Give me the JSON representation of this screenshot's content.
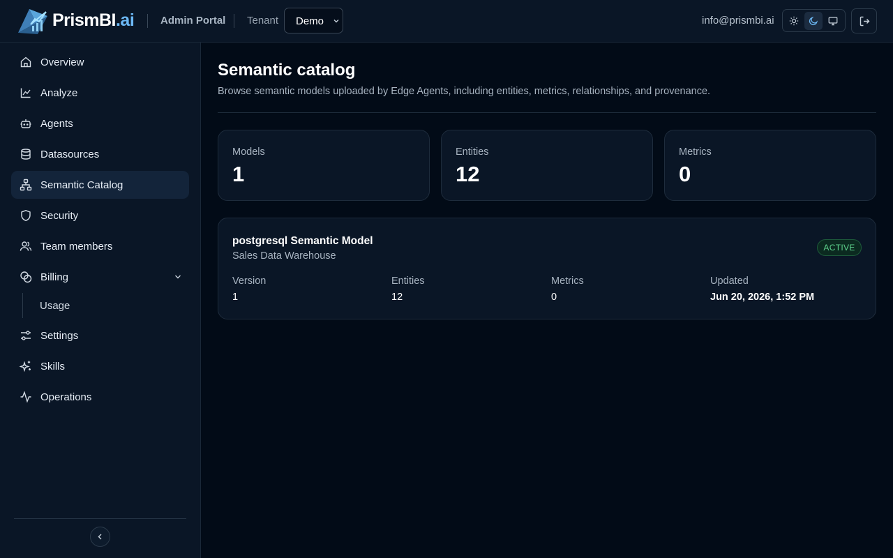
{
  "header": {
    "brand_main": "PrismBI",
    "brand_suffix": ".ai",
    "portal": "Admin Portal",
    "tenant_label": "Tenant",
    "tenant_value": "Demo",
    "email": "info@prismbi.ai",
    "theme_options": [
      "sun-icon",
      "moon-icon",
      "monitor-icon"
    ],
    "active_theme": "moon-icon"
  },
  "sidebar": {
    "items": [
      {
        "label": "Overview",
        "icon": "home-icon"
      },
      {
        "label": "Analyze",
        "icon": "line-chart-icon"
      },
      {
        "label": "Agents",
        "icon": "bot-icon"
      },
      {
        "label": "Datasources",
        "icon": "database-icon"
      },
      {
        "label": "Semantic Catalog",
        "icon": "network-icon",
        "active": true
      },
      {
        "label": "Security",
        "icon": "shield-icon"
      },
      {
        "label": "Team members",
        "icon": "users-icon"
      },
      {
        "label": "Billing",
        "icon": "coins-icon",
        "expanded": true
      },
      {
        "label": "Settings",
        "icon": "sliders-icon"
      },
      {
        "label": "Skills",
        "icon": "sparkles-icon"
      },
      {
        "label": "Operations",
        "icon": "activity-icon"
      }
    ],
    "billing_sub": [
      {
        "label": "Usage"
      }
    ]
  },
  "main": {
    "title": "Semantic catalog",
    "subtitle": "Browse semantic models uploaded by Edge Agents, including entities, metrics, relationships, and provenance.",
    "stats": [
      {
        "label": "Models",
        "value": "1"
      },
      {
        "label": "Entities",
        "value": "12"
      },
      {
        "label": "Metrics",
        "value": "0"
      }
    ],
    "model": {
      "title": "postgresql Semantic Model",
      "subtitle": "Sales Data Warehouse",
      "status": "ACTIVE",
      "fields": [
        {
          "label": "Version",
          "value": "1"
        },
        {
          "label": "Entities",
          "value": "12"
        },
        {
          "label": "Metrics",
          "value": "0"
        },
        {
          "label": "Updated",
          "value": "Jun 20, 2026, 1:52 PM"
        }
      ]
    }
  },
  "colors": {
    "background": "#020b17",
    "panel": "#0a1626",
    "accent": "#6cb8f5",
    "active_badge": "#5fd48e"
  }
}
